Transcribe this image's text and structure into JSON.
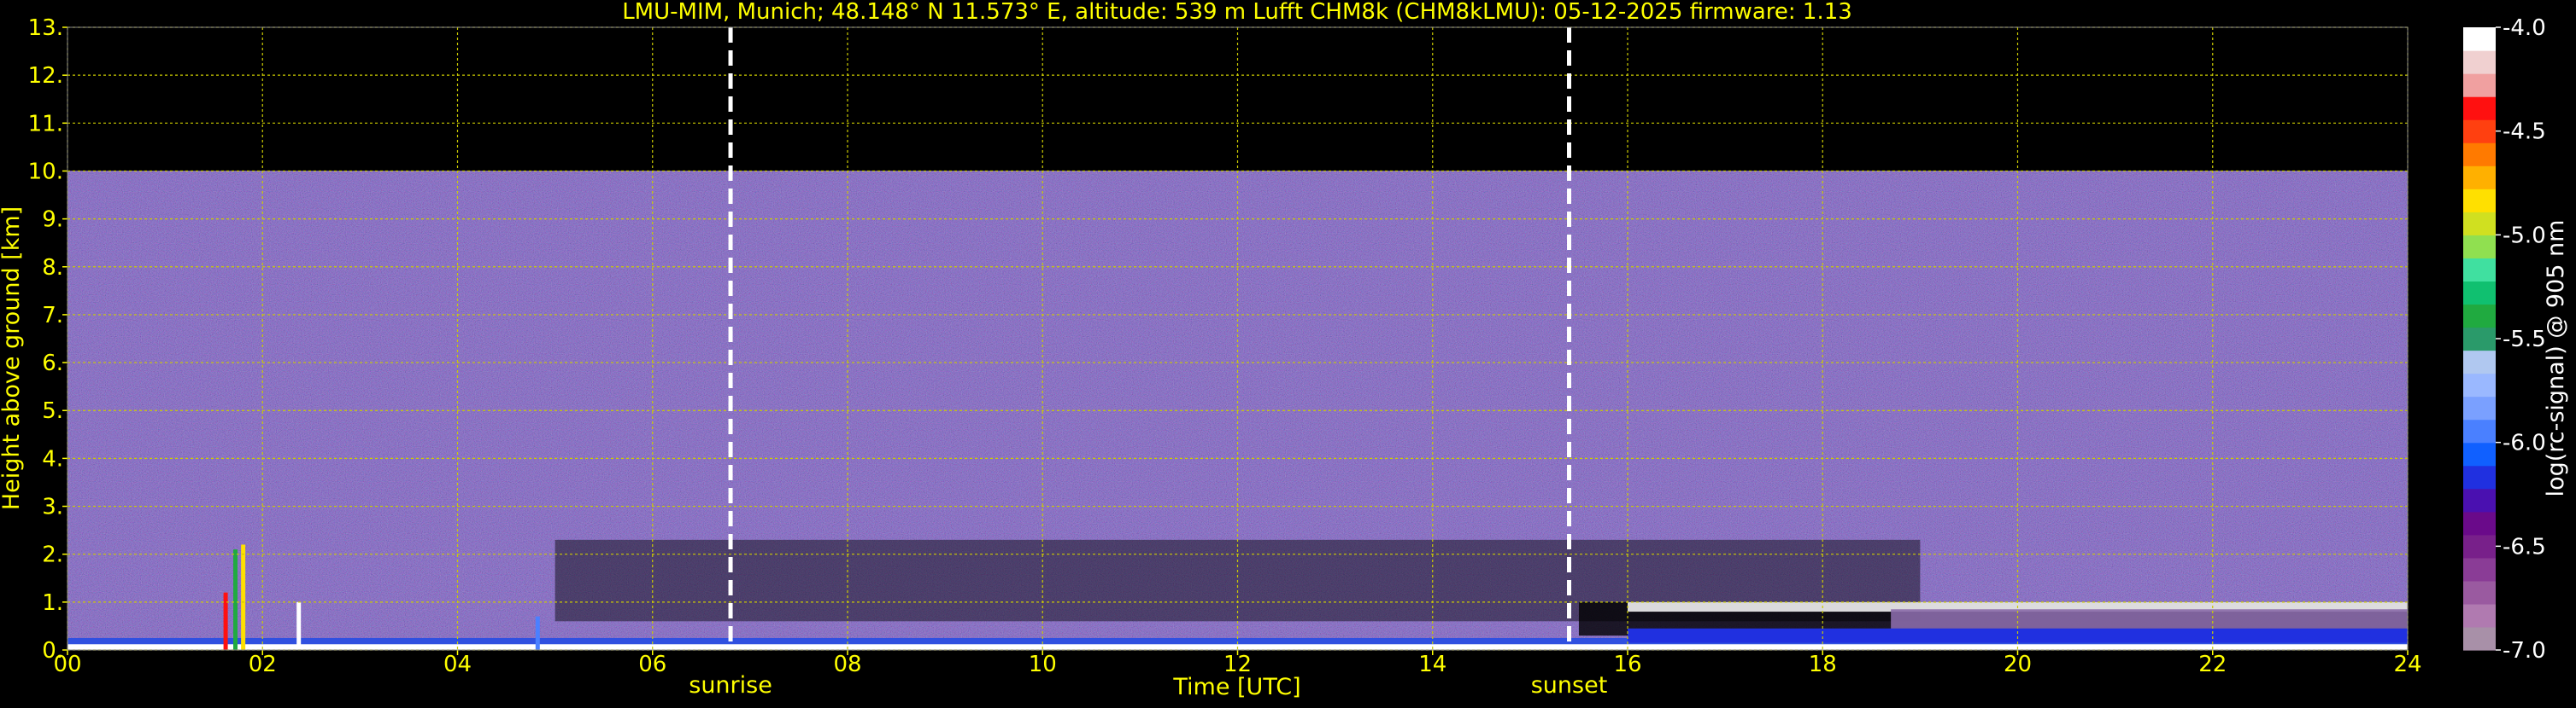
{
  "chart_data": {
    "type": "heatmap",
    "title": "LMU-MIM, Munich; 48.148° N 11.573° E, altitude: 539 m    Lufft CHM8k (CHM8kLMU): 05-12-2025    firmware: 1.13",
    "xlabel": "Time [UTC]",
    "ylabel": "Height above ground [km]",
    "xlim": [
      0,
      24
    ],
    "ylim": [
      0,
      13
    ],
    "x_ticks": [
      0,
      2,
      4,
      6,
      8,
      10,
      12,
      14,
      16,
      18,
      20,
      22,
      24
    ],
    "x_tick_labels": [
      "00",
      "02",
      "04",
      "06",
      "08",
      "10",
      "12",
      "14",
      "16",
      "18",
      "20",
      "22",
      "24"
    ],
    "y_ticks": [
      0,
      1,
      2,
      3,
      4,
      5,
      6,
      7,
      8,
      9,
      10,
      11,
      12,
      13
    ],
    "y_tick_labels": [
      "0.",
      "1.",
      "2.",
      "3.",
      "4.",
      "5.",
      "6.",
      "7.",
      "8.",
      "9.",
      "10.",
      "11.",
      "12.",
      "13."
    ],
    "grid": true,
    "data_top_km": 10,
    "markers": [
      {
        "label": "sunrise",
        "time": 6.8
      },
      {
        "label": "sunset",
        "time": 15.4
      }
    ],
    "colorbar": {
      "label": "log(rc-signal) @ 905 nm",
      "range": [
        -7.0,
        -4.0
      ],
      "tick_values": [
        -4.0,
        -4.5,
        -5.0,
        -5.5,
        -6.0,
        -6.5,
        -7.0
      ],
      "tick_labels": [
        "-4.0",
        "-4.5",
        "-5.0",
        "-5.5",
        "-6.0",
        "-6.5",
        "-7.0"
      ],
      "colors": [
        "#a890a8",
        "#b07ab0",
        "#9a5aa0",
        "#8a3c96",
        "#78208a",
        "#6a0a8a",
        "#4a10b0",
        "#2030e0",
        "#1060ff",
        "#4a80ff",
        "#7aa0ff",
        "#9ab8ff",
        "#b0c8f0",
        "#2a9a6a",
        "#20aa40",
        "#10c070",
        "#40e0a0",
        "#90e050",
        "#d0e020",
        "#ffe000",
        "#ffb000",
        "#ff7a00",
        "#ff4010",
        "#ff1010",
        "#f0a0a0",
        "#f0d0d0",
        "#ffffff"
      ]
    },
    "colors": {
      "axis_text": "#ffff00",
      "grid": "#cccc00",
      "cbar_text": "#ffffff",
      "background": "#000000",
      "noise_base": "#5a4a8a"
    }
  }
}
